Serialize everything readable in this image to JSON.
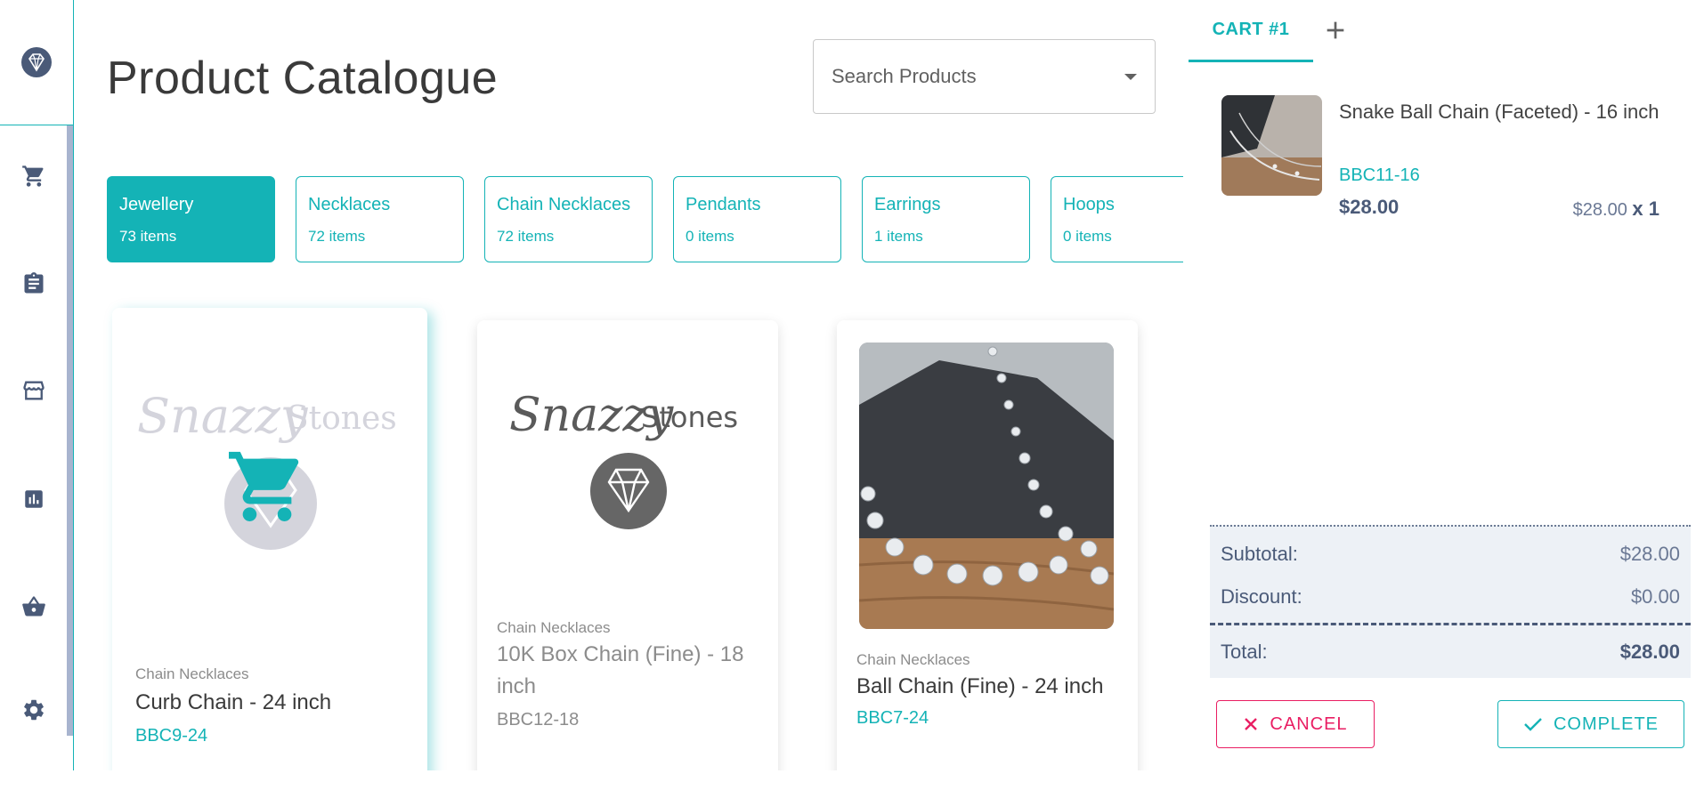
{
  "sidebar": {
    "items": [
      {
        "icon": "cart-icon"
      },
      {
        "icon": "clipboard-icon"
      },
      {
        "icon": "store-icon"
      },
      {
        "icon": "bar-chart-icon"
      },
      {
        "icon": "basket-icon"
      },
      {
        "icon": "gear-icon"
      }
    ]
  },
  "header": {
    "title": "Product Catalogue",
    "search_placeholder": "Search Products"
  },
  "categories": [
    {
      "name": "Jewellery",
      "count": "73 items",
      "active": true
    },
    {
      "name": "Necklaces",
      "count": "72 items"
    },
    {
      "name": "Chain Necklaces",
      "count": "72 items"
    },
    {
      "name": "Pendants",
      "count": "0 items"
    },
    {
      "name": "Earrings",
      "count": "1 items"
    },
    {
      "name": "Hoops",
      "count": "0 items"
    }
  ],
  "products": [
    {
      "category": "Chain Necklaces",
      "name": "Curb Chain - 24 inch",
      "sku": "BBC9-24"
    },
    {
      "category": "Chain Necklaces",
      "name": "10K Box Chain (Fine) - 18 inch",
      "sku": "BBC12-18"
    },
    {
      "category": "Chain Necklaces",
      "name": "Ball Chain (Fine) - 24 inch",
      "sku": "BBC7-24"
    }
  ],
  "brand": {
    "logo_word1": "Snazzy",
    "logo_word2": "Stones"
  },
  "cart": {
    "tab_label": "CART #1",
    "item": {
      "name": "Snake Ball Chain (Faceted) - 16 inch",
      "sku": "BBC11-16",
      "price": "$28.00",
      "unit_price": "$28.00",
      "qty": "x 1"
    },
    "subtotal_label": "Subtotal:",
    "subtotal": "$28.00",
    "discount_label": "Discount:",
    "discount": "$0.00",
    "total_label": "Total:",
    "total": "$28.00",
    "cancel_label": "CANCEL",
    "complete_label": "COMPLETE"
  },
  "colors": {
    "accent": "#14b3b6",
    "danger": "#e91e63",
    "sidebar_icon": "#4a5a78"
  }
}
